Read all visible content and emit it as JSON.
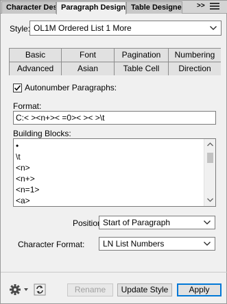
{
  "panel_tabs": [
    "Character Designer",
    "Paragraph Designer",
    "Table Designer"
  ],
  "panel_tabs_more": ">>",
  "style": {
    "label": "Style:",
    "value": "OL1M Ordered List 1 More"
  },
  "property_tabs": {
    "row1": [
      "Basic",
      "Font",
      "Pagination",
      "Numbering"
    ],
    "row2": [
      "Advanced",
      "Asian",
      "Table Cell",
      "Direction"
    ]
  },
  "autonumber": {
    "label": "Autonumber Paragraphs:",
    "checked": true
  },
  "format": {
    "label": "Format:",
    "value": "C:< ><n+>< =0>< >< >\\t"
  },
  "building_blocks": {
    "label": "Building Blocks:",
    "items": [
      "•",
      "\\t",
      "<n>",
      "<n+>",
      "<n=1>",
      "<a>"
    ]
  },
  "position": {
    "label": "Position:",
    "value": "Start of Paragraph"
  },
  "character_format": {
    "label": "Character Format:",
    "value": "LN List Numbers"
  },
  "buttons": {
    "rename": "Rename",
    "update_style": "Update Style",
    "apply": "Apply"
  }
}
